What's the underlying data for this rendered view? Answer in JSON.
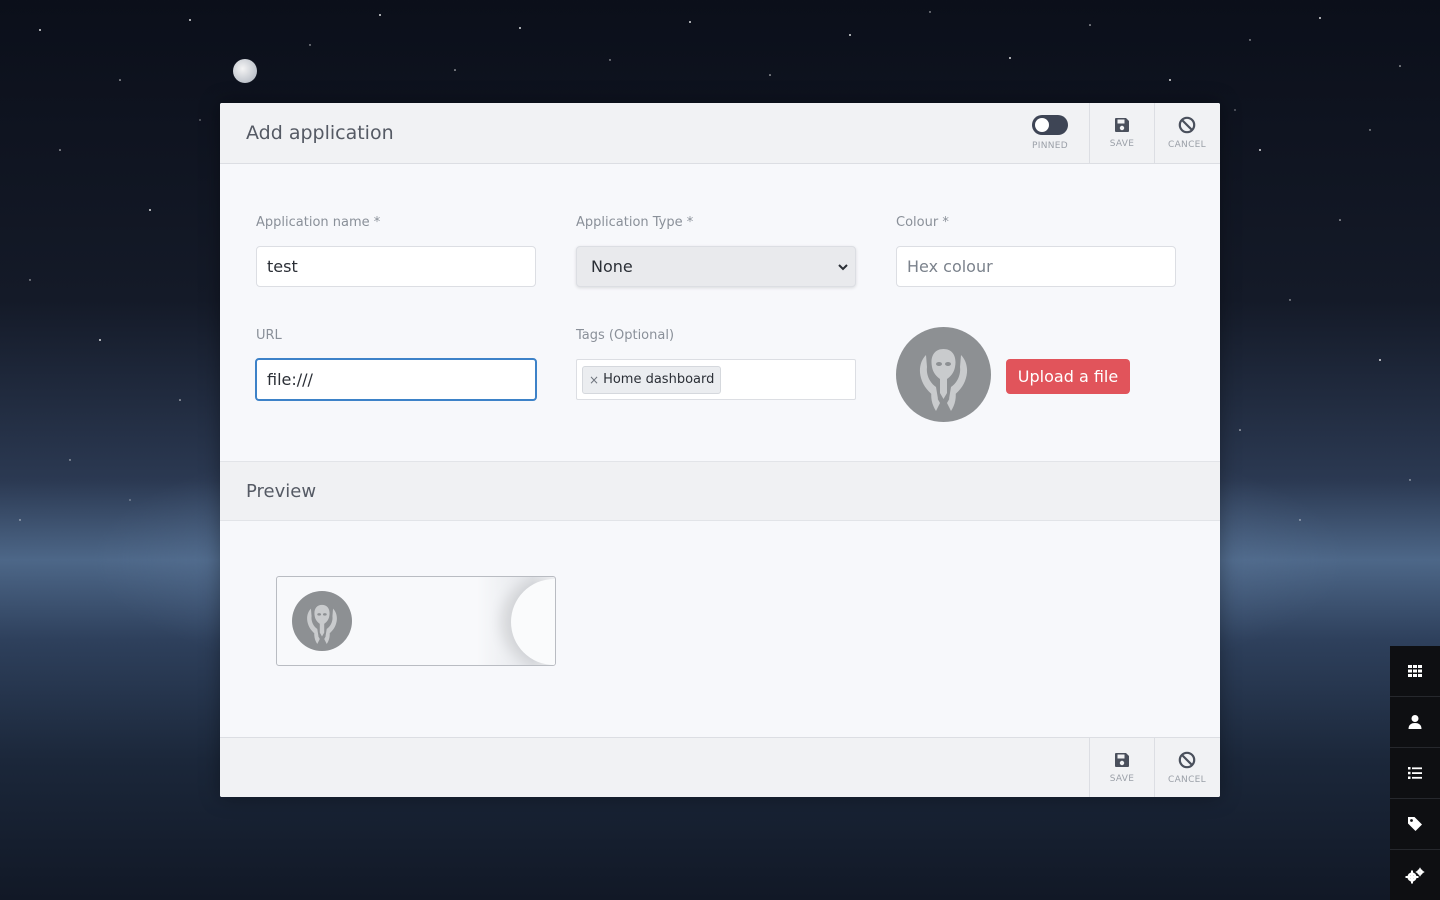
{
  "modal": {
    "title": "Add application",
    "pinned_label": "PINNED",
    "pinned": false,
    "save_label": "SAVE",
    "cancel_label": "CANCEL"
  },
  "form": {
    "app_name": {
      "label": "Application name *",
      "value": "test"
    },
    "app_type": {
      "label": "Application Type *",
      "value": "None"
    },
    "colour": {
      "label": "Colour *",
      "placeholder": "Hex colour",
      "value": ""
    },
    "url": {
      "label": "URL",
      "value": "file:///"
    },
    "tags": {
      "label": "Tags (Optional)",
      "items": [
        "Home dashboard"
      ]
    },
    "upload_label": "Upload a file"
  },
  "preview": {
    "title": "Preview"
  },
  "footer": {
    "save_label": "SAVE",
    "cancel_label": "CANCEL"
  },
  "sidebar": {
    "items": [
      {
        "icon": "grid-icon"
      },
      {
        "icon": "user-icon"
      },
      {
        "icon": "list-icon"
      },
      {
        "icon": "tag-icon"
      },
      {
        "icon": "cogs-icon"
      }
    ]
  },
  "colors": {
    "accent_red": "#e1545b",
    "focus_blue": "#3d82c8",
    "toggle_dark": "#3e4555"
  }
}
